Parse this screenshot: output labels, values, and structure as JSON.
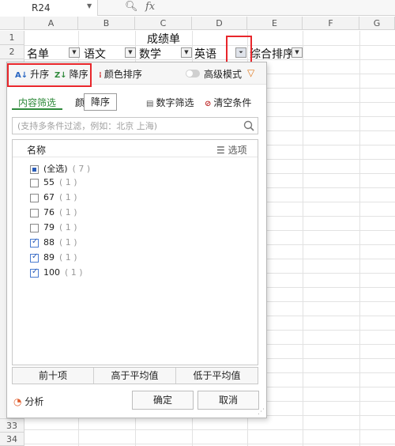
{
  "formula_bar": {
    "cell_ref": "R24",
    "fx_label": "fx"
  },
  "columns": [
    "A",
    "B",
    "C",
    "D",
    "E",
    "F",
    "G"
  ],
  "rows_top": [
    "1",
    "2"
  ],
  "rows_bottom": [
    "33",
    "34"
  ],
  "sheet": {
    "title": "成绩单",
    "headers": [
      "名单",
      "语文",
      "数学",
      "英语",
      "综合排序"
    ]
  },
  "filter_panel": {
    "sort_asc": "升序",
    "sort_desc": "降序",
    "color_sort": "颜色排序",
    "advanced_mode": "高级模式",
    "tab_content": "内容筛选",
    "tab_color_partial": "颜",
    "tooltip": "降序",
    "number_filter": "数字筛选",
    "clear_filter": "清空条件",
    "search_placeholder": "(支持多条件过滤，例如：北京 上海)",
    "list_header": "名称",
    "options_label": "选项",
    "items": [
      {
        "label": "(全选)",
        "count": "( 7 )",
        "state": "partial"
      },
      {
        "label": "55",
        "count": "( 1 )",
        "state": "unchecked"
      },
      {
        "label": "67",
        "count": "( 1 )",
        "state": "unchecked"
      },
      {
        "label": "76",
        "count": "( 1 )",
        "state": "unchecked"
      },
      {
        "label": "79",
        "count": "( 1 )",
        "state": "unchecked"
      },
      {
        "label": "88",
        "count": "( 1 )",
        "state": "checked"
      },
      {
        "label": "89",
        "count": "( 1 )",
        "state": "checked"
      },
      {
        "label": "100",
        "count": "( 1 )",
        "state": "checked"
      }
    ],
    "top_ten": "前十项",
    "above_avg": "高于平均值",
    "below_avg": "低于平均值",
    "analysis": "分析",
    "ok": "确定",
    "cancel": "取消"
  },
  "colors": {
    "accent_green": "#2f8a3b",
    "highlight_red": "#e8262b",
    "checkbox_blue": "#2a5cb8"
  }
}
